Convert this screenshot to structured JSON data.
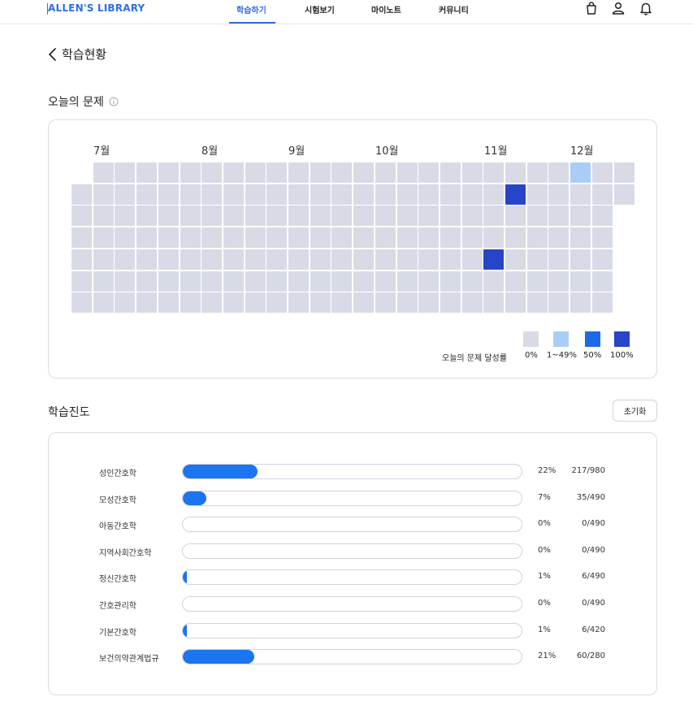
{
  "header": {
    "brand": "ALLEN'S LIBRARY",
    "nav": [
      {
        "label": "학습하기",
        "active": true
      },
      {
        "label": "시험보기",
        "active": false
      },
      {
        "label": "마이노트",
        "active": false
      },
      {
        "label": "커뮤니티",
        "active": false
      }
    ],
    "icons": [
      "bag-icon",
      "user-icon",
      "bell-icon"
    ]
  },
  "page": {
    "title": "학습현황"
  },
  "today": {
    "title": "오늘의 문제",
    "months": [
      "7월",
      "8월",
      "9월",
      "10월",
      "11월",
      "12월"
    ],
    "colors": {
      "empty": "#d8dbe6",
      "low": "#a9cdf7",
      "half": "#1b6ae6",
      "full": "#2645c8"
    },
    "highlighted_cells": [
      {
        "week": 23,
        "day": 0,
        "level": "low"
      },
      {
        "week": 20,
        "day": 1,
        "level": "full"
      },
      {
        "week": 19,
        "day": 4,
        "level": "full"
      }
    ],
    "legend": {
      "title": "오늘의 문제 달성률",
      "items": [
        {
          "label": "0%",
          "level": "empty"
        },
        {
          "label": "1~49%",
          "level": "low"
        },
        {
          "label": "50%",
          "level": "half"
        },
        {
          "label": "100%",
          "level": "full"
        }
      ]
    }
  },
  "progress": {
    "title": "학습진도",
    "reset_label": "초기화",
    "accent": "#1b74f0",
    "rows": [
      {
        "label": "성인간호학",
        "percent": "22%",
        "count": "217/980",
        "ratio": 0.22
      },
      {
        "label": "모성간호학",
        "percent": "7%",
        "count": "35/490",
        "ratio": 0.07
      },
      {
        "label": "아동간호학",
        "percent": "0%",
        "count": "0/490",
        "ratio": 0
      },
      {
        "label": "지역사회간호학",
        "percent": "0%",
        "count": "0/490",
        "ratio": 0
      },
      {
        "label": "정신간호학",
        "percent": "1%",
        "count": "6/490",
        "ratio": 0.01
      },
      {
        "label": "간호관리학",
        "percent": "0%",
        "count": "0/490",
        "ratio": 0
      },
      {
        "label": "기본간호학",
        "percent": "1%",
        "count": "6/420",
        "ratio": 0.01
      },
      {
        "label": "보건의약관계법규",
        "percent": "21%",
        "count": "60/280",
        "ratio": 0.21
      }
    ]
  }
}
